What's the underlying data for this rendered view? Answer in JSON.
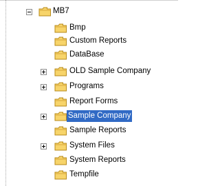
{
  "tree": {
    "root": {
      "label": "MB7",
      "expanded": true
    },
    "children": [
      {
        "label": "Bmp",
        "expandable": false
      },
      {
        "label": "Custom Reports",
        "expandable": false
      },
      {
        "label": "DataBase",
        "expandable": false
      },
      {
        "label": "OLD Sample Company",
        "expandable": true
      },
      {
        "label": "Programs",
        "expandable": true
      },
      {
        "label": "Report Forms",
        "expandable": false
      },
      {
        "label": "Sample Company",
        "expandable": true,
        "selected": true
      },
      {
        "label": "Sample Reports",
        "expandable": false
      },
      {
        "label": "System Files",
        "expandable": true
      },
      {
        "label": "System Reports",
        "expandable": false
      },
      {
        "label": "Tempfile",
        "expandable": false
      }
    ]
  },
  "colors": {
    "folder": "#f7d46a",
    "selection": "#316ac5"
  },
  "icons": {
    "folder": "folder-icon",
    "expand": "plus-expander-icon",
    "collapse": "minus-expander-icon"
  }
}
